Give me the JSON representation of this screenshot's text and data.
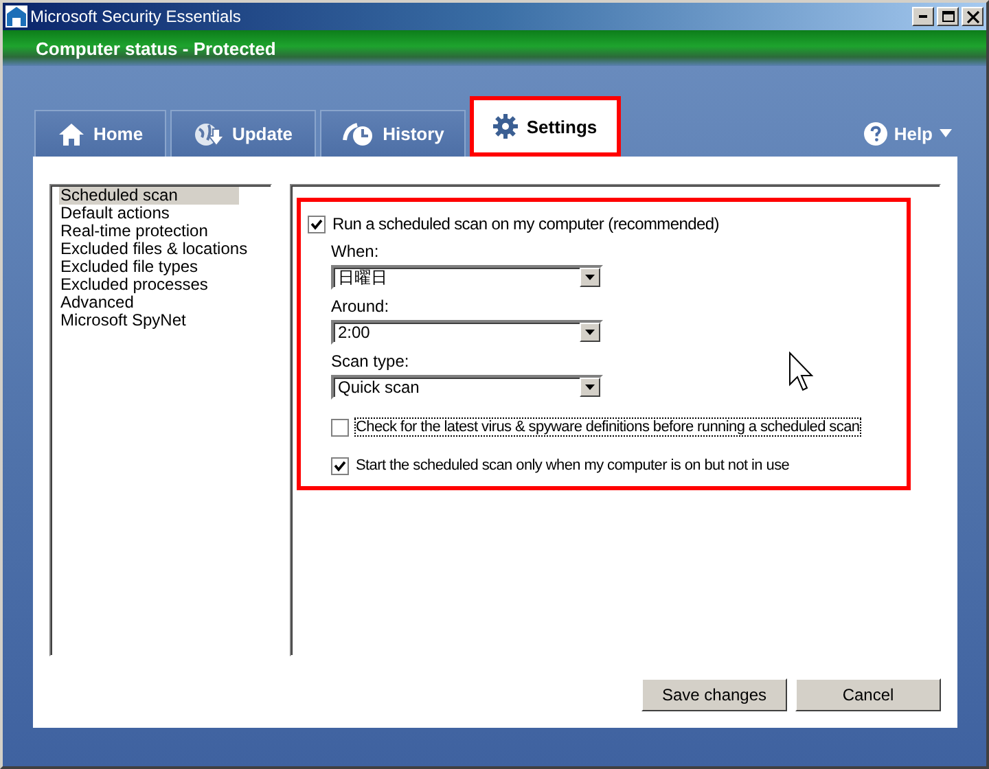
{
  "window": {
    "title": "Microsoft Security Essentials"
  },
  "status": {
    "text": "Computer status - Protected"
  },
  "tabs": [
    {
      "label": "Home",
      "selected": false,
      "highlighted": false
    },
    {
      "label": "Update",
      "selected": false,
      "highlighted": false
    },
    {
      "label": "History",
      "selected": false,
      "highlighted": false
    },
    {
      "label": "Settings",
      "selected": true,
      "highlighted": true
    }
  ],
  "help": {
    "label": "Help"
  },
  "sidebar": {
    "items": [
      {
        "label": "Scheduled scan",
        "selected": true
      },
      {
        "label": "Default actions",
        "selected": false
      },
      {
        "label": "Real-time protection",
        "selected": false
      },
      {
        "label": "Excluded files & locations",
        "selected": false
      },
      {
        "label": "Excluded file types",
        "selected": false
      },
      {
        "label": "Excluded processes",
        "selected": false
      },
      {
        "label": "Advanced",
        "selected": false
      },
      {
        "label": "Microsoft SpyNet",
        "selected": false
      }
    ]
  },
  "options": {
    "highlighted": true,
    "items": [
      {
        "kind": "checkbox",
        "label": "Run a scheduled scan on my computer (recommended)",
        "checked": true
      },
      {
        "kind": "select",
        "label": "When:",
        "value": "日曜日"
      },
      {
        "kind": "select",
        "label": "Around:",
        "value": "2:00"
      },
      {
        "kind": "select",
        "label": "Scan type:",
        "value": "Quick scan"
      },
      {
        "kind": "checkbox",
        "label": "Check for the latest virus & spyware definitions before running a scheduled scan",
        "checked": false,
        "focused": true
      },
      {
        "kind": "checkbox",
        "label": "Start the scheduled scan only when my computer is on but not in use",
        "checked": true
      }
    ]
  },
  "buttons": [
    "Save changes",
    "Cancel"
  ]
}
